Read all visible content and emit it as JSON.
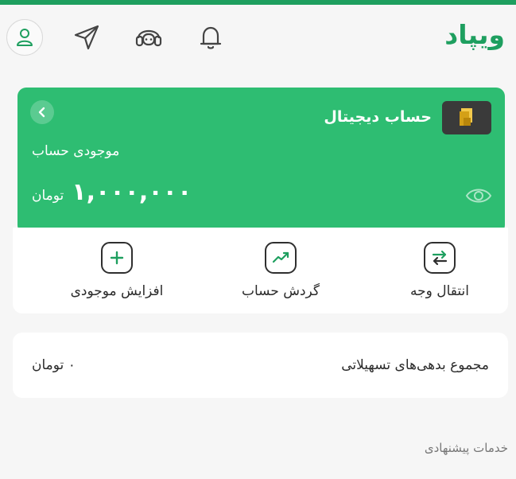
{
  "app": {
    "logo_text": "ویپاد",
    "brand_color": "#1e9f5f",
    "card_color": "#2ebd72"
  },
  "header": {
    "icons": [
      "user-icon",
      "send-icon",
      "support-icon",
      "bell-icon"
    ]
  },
  "account_card": {
    "title": "حساب دیجیتال",
    "balance_label": "موجودی حساب",
    "balance_amount": "۱,۰۰۰,۰۰۰",
    "balance_unit": "تومان",
    "icons": [
      "bank-logo-icon",
      "chevron-left-icon",
      "eye-icon"
    ]
  },
  "actions": [
    {
      "label": "انتقال وجه",
      "icon": "transfer-arrows-icon"
    },
    {
      "label": "گردش حساب",
      "icon": "trend-chart-icon"
    },
    {
      "label": "افزایش موجودی",
      "icon": "plus-icon"
    }
  ],
  "debt": {
    "label": "مجموع بدهی‌های تسهیلاتی",
    "value": "۰ تومان"
  },
  "suggested_services": {
    "title": "خدمات پیشنهادی"
  }
}
